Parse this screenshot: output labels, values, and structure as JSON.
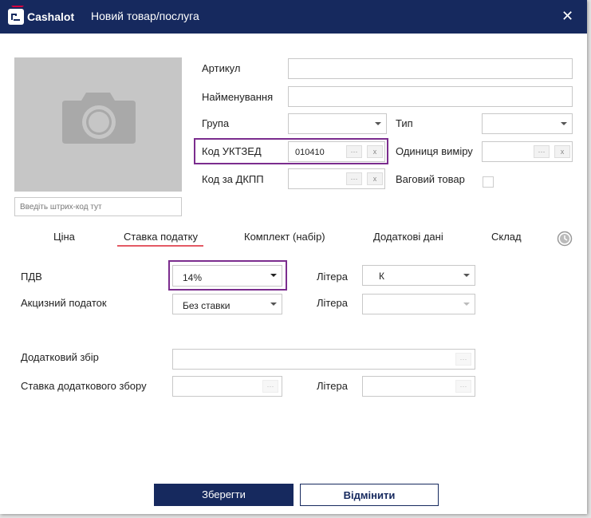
{
  "titlebar": {
    "logo": "Cashalot",
    "title": "Новий товар/послуга",
    "close": "✕"
  },
  "photo": {
    "barcode_placeholder": "Введіть штрих-код тут"
  },
  "form": {
    "articul_label": "Артикул",
    "name_label": "Найменування",
    "group_label": "Група",
    "type_label": "Тип",
    "uktzed_label": "Код УКТЗЕД",
    "uktzed_value": "010410",
    "unit_label": "Одиниця виміру",
    "dkpp_label": "Код за ДКПП",
    "weight_label": "Ваговий товар",
    "dots": "···",
    "x": "x"
  },
  "tabs": [
    "Ціна",
    "Ставка податку",
    "Комплект (набір)",
    "Додаткові дані",
    "Склад"
  ],
  "active_tab": "Ставка податку",
  "tax": {
    "pdv_label": "ПДВ",
    "pdv_value": "14%",
    "excise_label": "Акцизний податок",
    "excise_value": "Без ставки",
    "litera_label": "Літера",
    "litera_value": "К",
    "extra_fee_label": "Додатковий збір",
    "extra_rate_label": "Ставка додаткового збору"
  },
  "buttons": {
    "save": "Зберегти",
    "cancel": "Відмінити"
  },
  "colors": {
    "titlebar": "#16295e",
    "highlight": "#7b2d8e",
    "tab_underline": "#e45a65"
  }
}
